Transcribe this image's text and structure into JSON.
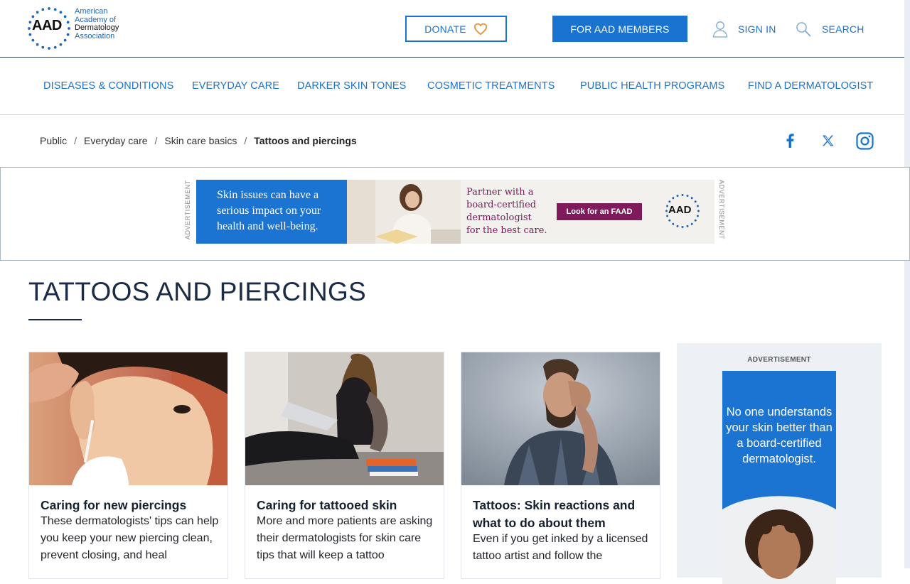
{
  "header": {
    "logo": {
      "abbr": "AAD",
      "line1": "American",
      "line2": "Academy of",
      "line3": "Dermatology",
      "line4": "Association"
    },
    "donate_label": "DONATE",
    "members_label": "FOR AAD MEMBERS",
    "signin_label": "SIGN IN",
    "search_label": "SEARCH"
  },
  "nav": {
    "items": [
      {
        "label": "DISEASES & CONDITIONS"
      },
      {
        "label": "EVERYDAY CARE"
      },
      {
        "label": "DARKER SKIN TONES"
      },
      {
        "label": "COSMETIC TREATMENTS"
      },
      {
        "label": "PUBLIC HEALTH PROGRAMS"
      },
      {
        "label": "FIND A DERMATOLOGIST"
      }
    ]
  },
  "breadcrumb": {
    "items": [
      "Public",
      "Everyday care",
      "Skin care basics"
    ],
    "separator": "/",
    "current": "Tattoos and piercings"
  },
  "social": {
    "facebook": "facebook-icon",
    "x": "x-icon",
    "instagram": "instagram-icon"
  },
  "top_ad": {
    "label": "ADVERTISEMENT",
    "blue_line1": "Skin issues can have a",
    "blue_line2": "serious impact on your",
    "blue_line3": "health and well-being.",
    "partner_line1": "Partner with a",
    "partner_line2": "board-certified",
    "partner_line3": "dermatologist",
    "partner_line4": "for the best care.",
    "cta": "Look for an FAAD",
    "logo": "AAD"
  },
  "page": {
    "title": "TATTOOS AND PIERCINGS"
  },
  "cards": [
    {
      "title": "Caring for new piercings",
      "desc": "These dermatologists' tips can help you keep your new piercing clean, prevent closing, and heal"
    },
    {
      "title": "Caring for tattooed skin",
      "desc": "More and more patients are asking their dermatologists for skin care tips that will keep a tattoo"
    },
    {
      "title": "Tattoos: Skin reactions and what to do about them",
      "desc": "Even if you get inked by a licensed tattoo artist and follow the"
    }
  ],
  "side_ad": {
    "label": "ADVERTISEMENT",
    "text": "No one understands your skin better than a board-certified dermatologist."
  },
  "colors": {
    "accent": "#1a73d0",
    "heading": "#1b2b45",
    "ad_magenta": "#7f1b5c",
    "heart": "#e8913a"
  }
}
